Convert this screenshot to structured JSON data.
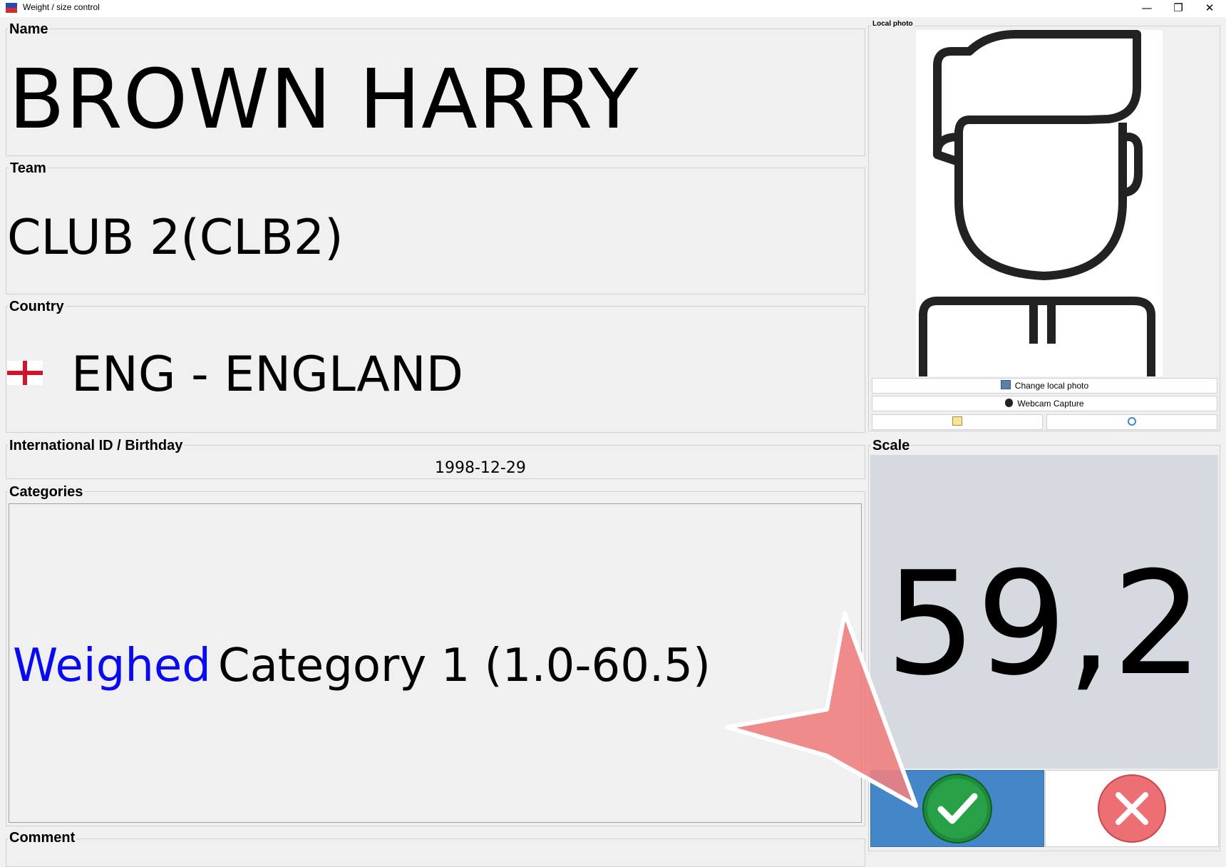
{
  "window": {
    "title": "Weight / size control",
    "minimize_glyph": "—",
    "restore_glyph": "❐",
    "close_glyph": "✕"
  },
  "name_group": {
    "label": "Name",
    "value": "BROWN HARRY"
  },
  "team_group": {
    "label": "Team",
    "value": "CLUB 2(CLB2)"
  },
  "country_group": {
    "label": "Country",
    "value": "ENG - ENGLAND",
    "flag_icon": "england-flag-icon"
  },
  "id_group": {
    "label": "International ID / Birthday",
    "birthday": "1998-12-29"
  },
  "categories_group": {
    "label": "Categories",
    "status": "Weighed",
    "category": "Category 1 (1.0-60.5)",
    "status_color": "#0a0af0"
  },
  "comment_group": {
    "label": "Comment"
  },
  "photo": {
    "label": "Local photo",
    "change_button": "Change local photo",
    "webcam_button": "Webcam Capture",
    "edit_icon": "edit-photo-icon",
    "refresh_icon": "refresh-photo-icon"
  },
  "scale": {
    "label": "Scale",
    "value": "59,2"
  },
  "actions": {
    "confirm_icon": "checkmark-icon",
    "cancel_icon": "cross-icon",
    "confirm_color": "#4487c9"
  }
}
